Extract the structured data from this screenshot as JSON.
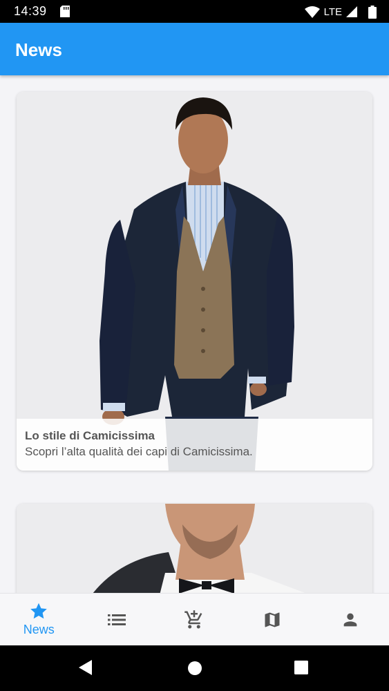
{
  "status_bar": {
    "time": "14:39",
    "network": "LTE",
    "icons": [
      "sd-card-icon",
      "wifi-icon",
      "signal-icon",
      "battery-icon"
    ]
  },
  "app_bar": {
    "title": "News"
  },
  "feed": {
    "cards": [
      {
        "title": "Lo stile di Camicissima",
        "subtitle": "Scopri l’alta qualità dei capi di Camicissima.",
        "image": "man-in-navy-blazer-photo"
      },
      {
        "image": "man-with-bow-tie-photo"
      }
    ]
  },
  "bottom_nav": {
    "items": [
      {
        "icon": "star-icon",
        "label": "News",
        "active": true
      },
      {
        "icon": "list-icon"
      },
      {
        "icon": "add-to-cart-icon"
      },
      {
        "icon": "map-icon"
      },
      {
        "icon": "person-icon"
      }
    ],
    "active_color": "#2196f3",
    "inactive_color": "#555555"
  },
  "system_nav": {
    "buttons": [
      "back-icon",
      "home-icon",
      "recents-icon"
    ]
  },
  "colors": {
    "primary": "#2196f3",
    "background": "#f4f4f7"
  }
}
